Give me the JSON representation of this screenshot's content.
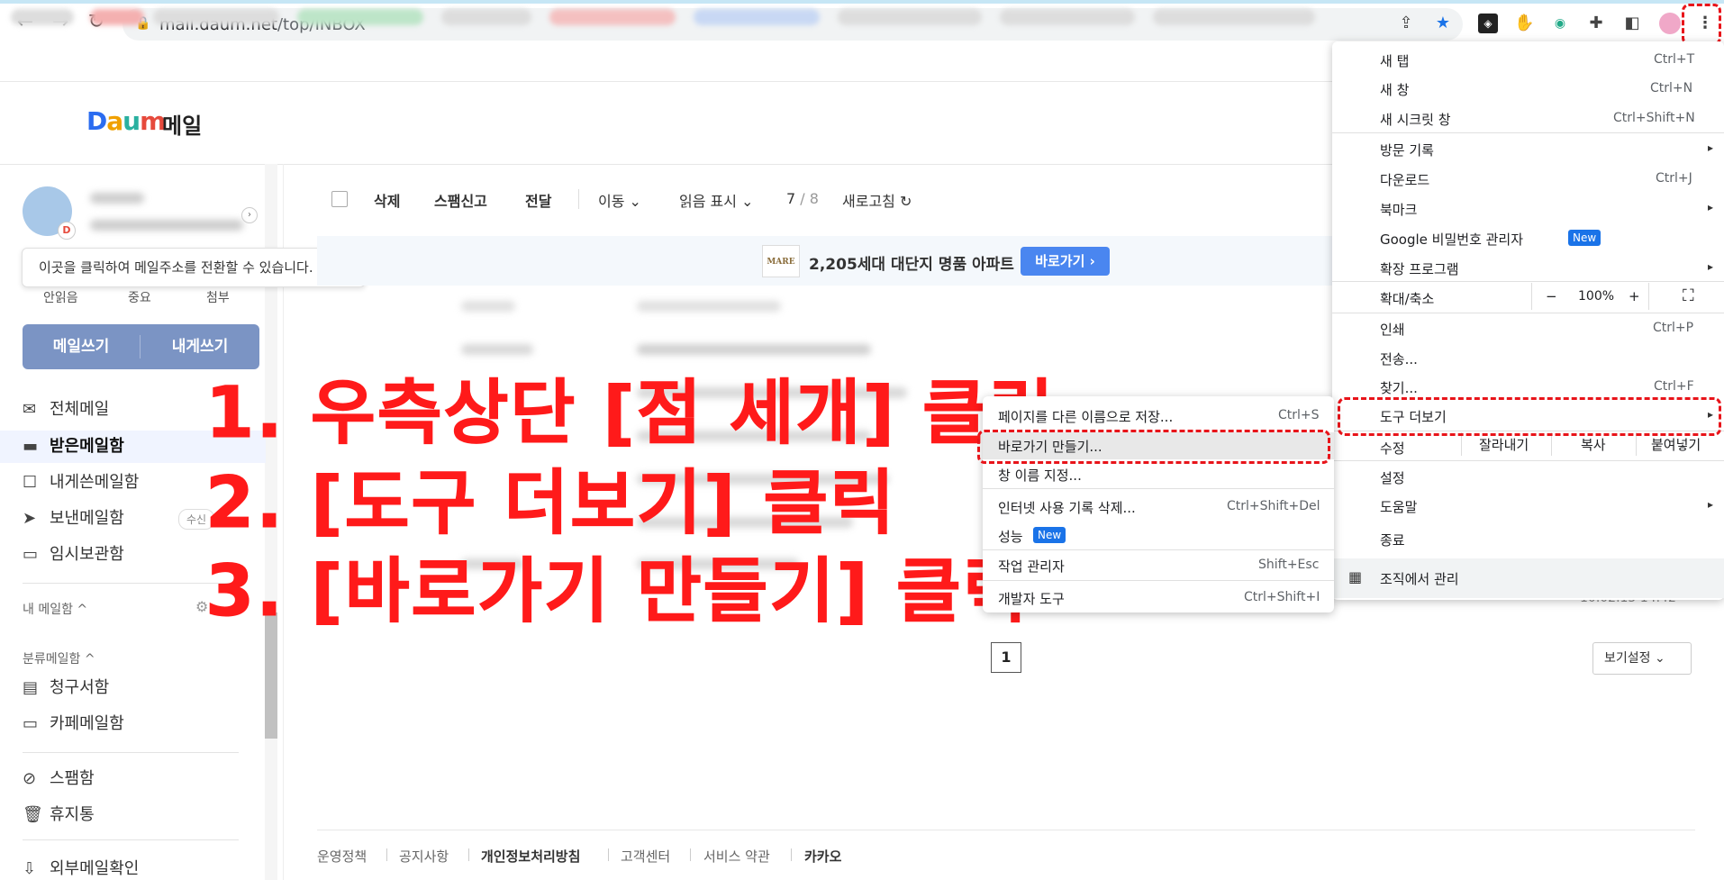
{
  "browser": {
    "url_host": "mail.daum.net",
    "url_path": "/top/INBOX"
  },
  "brand": {
    "logo_d": "D",
    "logo_a": "a",
    "logo_u": "u",
    "logo_m": "m",
    "title": "메일"
  },
  "sidebar": {
    "tooltip": "이곳을 클릭하여 메일주소를 전환할 수 있습니다.",
    "stats": [
      "안읽음",
      "중요",
      "첨부"
    ],
    "write_button": "메일쓰기",
    "self_write_button": "내게쓰기",
    "items": [
      {
        "label": "전체메일",
        "icon": "✉"
      },
      {
        "label": "받은메일함",
        "icon": "▬"
      },
      {
        "label": "내게쓴메일함",
        "icon": "☐"
      },
      {
        "label": "보낸메일함",
        "icon": "➤"
      },
      {
        "label": "임시보관함",
        "icon": "▭"
      }
    ],
    "sent_badge": "수신",
    "my_mailbox": "내 메일함 ^",
    "category_mailbox": "분류메일함 ^",
    "category_items": [
      {
        "label": "청구서함",
        "icon": "▤"
      },
      {
        "label": "카페메일함",
        "icon": "▭"
      }
    ],
    "bottom_items": [
      {
        "label": "스팸함",
        "icon": "⊘"
      },
      {
        "label": "휴지통",
        "icon": "🗑"
      },
      {
        "label": "외부메일확인",
        "icon": "⇩"
      }
    ]
  },
  "mail_toolbar": {
    "delete": "삭제",
    "report_spam": "스팸신고",
    "forward": "전달",
    "move": "이동 ⌄",
    "mark_read": "읽음 표시 ⌄",
    "page_current": "7",
    "page_total": "/ 8",
    "refresh": "새로고침 ↻"
  },
  "banner": {
    "logo": "MARE",
    "text": "2,205세대 대단지 명품 아파트",
    "button": "바로가기 ›"
  },
  "pagination": {
    "page": "1",
    "view_settings": "보기설정 ⌄"
  },
  "partial_time": "10.02.15 14.42",
  "footer": [
    "운영정책",
    "공지사항",
    "개인정보처리방침",
    "고객센터",
    "서비스 약관",
    "카카오"
  ],
  "chrome_menu": {
    "new_tab": "새 탭",
    "new_tab_sc": "Ctrl+T",
    "new_window": "새 창",
    "new_window_sc": "Ctrl+N",
    "incognito": "새 시크릿 창",
    "incognito_sc": "Ctrl+Shift+N",
    "history": "방문 기록",
    "downloads": "다운로드",
    "downloads_sc": "Ctrl+J",
    "bookmarks": "북마크",
    "passwords": "Google 비밀번호 관리자",
    "new_badge": "New",
    "extensions": "확장 프로그램",
    "zoom": "확대/축소",
    "zoom_minus": "−",
    "zoom_value": "100%",
    "zoom_plus": "+",
    "print": "인쇄",
    "print_sc": "Ctrl+P",
    "cast": "전송...",
    "find": "찾기...",
    "find_sc": "Ctrl+F",
    "more_tools": "도구 더보기",
    "edit": "수정",
    "cut": "잘라내기",
    "copy": "복사",
    "paste": "붙여넣기",
    "settings": "설정",
    "help": "도움말",
    "exit": "종료",
    "managed": "조직에서 관리"
  },
  "submenu": {
    "save_page": "페이지를 다른 이름으로 저장...",
    "save_page_sc": "Ctrl+S",
    "create_shortcut": "바로가기 만들기...",
    "name_window": "창 이름 지정...",
    "clear_data": "인터넷 사용 기록 삭제...",
    "clear_data_sc": "Ctrl+Shift+Del",
    "performance": "성능",
    "new_badge": "New",
    "task_manager": "작업 관리자",
    "task_manager_sc": "Shift+Esc",
    "dev_tools": "개발자 도구",
    "dev_tools_sc": "Ctrl+Shift+I"
  },
  "annotations": {
    "step1": "1. 우측상단 [점 세개] 클릭",
    "step2": "2. [도구 더보기] 클릭",
    "step3": "3. [바로가기 만들기] 클릭"
  },
  "colors": {
    "annotation_red": "#ff1a1a",
    "write_button": "#7b94c4",
    "banner_button": "#4a86f0",
    "badge_blue": "#1a73e8"
  }
}
